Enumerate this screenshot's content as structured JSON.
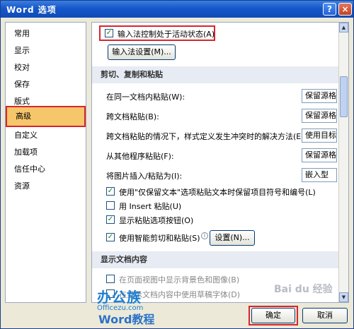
{
  "window": {
    "title": "Word 选项",
    "help_glyph": "?",
    "close_glyph": "×"
  },
  "sidebar": {
    "items": [
      "常用",
      "显示",
      "校对",
      "保存",
      "版式",
      "高级",
      "自定义",
      "加载项",
      "信任中心",
      "资源"
    ],
    "active": "高级"
  },
  "main": {
    "ime_checkbox_label": "输入法控制处于活动状态(A)",
    "ime_settings_button": "输入法设置(M)...",
    "section_cut_paste": "剪切、复制和粘贴",
    "paste_options": [
      {
        "label": "在同一文档内粘贴(W):",
        "value": "保留源格式"
      },
      {
        "label": "跨文档粘贴(B):",
        "value": "保留源格式"
      },
      {
        "label": "跨文档粘贴的情况下，样式定义发生冲突时的解决方法(E):",
        "value": "使用目标样式"
      },
      {
        "label": "从其他程序粘贴(F):",
        "value": "保留源格式"
      },
      {
        "label": "将图片插入/粘贴为(I):",
        "value": "嵌入型"
      }
    ],
    "checkboxes": [
      {
        "label": "使用\"仅保留文本\"选项粘贴文本时保留项目符号和编号(L)",
        "checked": true
      },
      {
        "label": "用 Insert 粘贴(U)",
        "checked": false
      },
      {
        "label": "显示粘贴选项按钮(O)",
        "checked": true
      },
      {
        "label": "使用智能剪切和粘贴(S)",
        "checked": true
      }
    ],
    "settings_button": "设置(N)...",
    "section_show_doc": "显示文档内容",
    "partial_option_1": "在页面视图中显示背景色和图像(B)",
    "partial_option_2": "在显示文档内容中使用草稿字体(D)"
  },
  "buttons": {
    "ok": "确定",
    "cancel": "取消"
  },
  "watermark": {
    "brand": "办公族",
    "site": "Officezu.com",
    "caption": "Word教程",
    "baidu": "Bai du 经验"
  },
  "check_glyph": "✓"
}
